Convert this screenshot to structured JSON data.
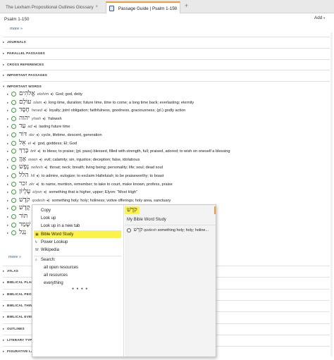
{
  "tabs": [
    {
      "label": "The Lexham Propositional Outlines Glossary",
      "close": "×"
    },
    {
      "label": "Passage Guide | Psalm 1-150",
      "close": "×"
    }
  ],
  "new_tab": "+",
  "toolbar": {
    "reference": "Psalm 1-150",
    "add_label": "Add",
    "add_caret": "▾"
  },
  "more_top": "more »",
  "sections_top": [
    "JOURNALS",
    "PARALLEL PASSAGES",
    "CROSS REFERENCES",
    "IMPORTANT PASSAGES",
    "IMPORTANT WORDS"
  ],
  "words": [
    {
      "hebrew": "אֱלֹהִים",
      "translit": "elohim",
      "gloss": "God; god, deity"
    },
    {
      "hebrew": "עוֹלָם",
      "translit": "olam",
      "gloss": "long time, duration; future time, time to come; a long time back; everlasting; eternity"
    },
    {
      "hebrew": "חֶסֶד",
      "translit": "hesed",
      "gloss": "loyalty; joint obligation; faithfulness, goodness, graciousness; (pl.) godly action"
    },
    {
      "hebrew": "יהוה",
      "translit": "yhwh",
      "gloss": "Yahweh"
    },
    {
      "hebrew": "עַד",
      "translit": "ad",
      "gloss": "lasting future time"
    },
    {
      "hebrew": "דּוֹר",
      "translit": "dor",
      "gloss": "cycle, lifetime, descent, generation"
    },
    {
      "hebrew": "אֵל",
      "translit": "el",
      "gloss": "god, goddess; El; God"
    },
    {
      "hebrew": "בָּרַךְ",
      "translit": "brk",
      "gloss": "to bless; to praise; (pt. pass) blessed, filled with strength, full; praised, adored; to wish on oneself a blessing"
    },
    {
      "hebrew": "אָוֶן",
      "translit": "owen",
      "gloss": "evil; calamity; sin, injustice; deception; false, idolatrous"
    },
    {
      "hebrew": "נֶפֶשׁ",
      "translit": "nefesh",
      "gloss": "throat; neck; breath; living being; personality; life; soul; dead soul"
    },
    {
      "hebrew": "הלל",
      "translit": "hll",
      "gloss": "to admire, eulogize; to exclaim Halleluiah; to be praiseworthy; to boast"
    },
    {
      "hebrew": "זכר",
      "translit": "zkr",
      "gloss": "to name, mention, remember; to take to court, make known, profess, praise"
    },
    {
      "hebrew": "עֶלְיוֹן",
      "translit": "elyon",
      "gloss": "something that is higher, upper; Elyon: “Most High”"
    },
    {
      "hebrew": "קֹדֶשׁ",
      "translit": "qodesh",
      "gloss": "something holy; holy; holiness; votive offerings; holy area, sanctuary"
    },
    {
      "hebrew": "קֶדֶשׁ",
      "translit": "",
      "gloss": ""
    },
    {
      "hebrew": "תּוֹר",
      "translit": "",
      "gloss": ""
    },
    {
      "hebrew": "שָׁמַר",
      "translit": "",
      "gloss": ""
    },
    {
      "hebrew": "נְגַל",
      "translit": "",
      "gloss": ""
    }
  ],
  "more_words": "more »",
  "sections_bottom": [
    "ATLAS",
    "BIBLICAL PLAC",
    "BIBLICAL PEOP",
    "BIBLICAL THIN",
    "BIBLICAL EVEN",
    "OUTLINES",
    "LITERARY TYPI",
    "FIGURATIVE LA"
  ],
  "context_menu": {
    "items": [
      {
        "label": "Copy",
        "icon": ""
      },
      {
        "label": "Look up",
        "icon": ""
      },
      {
        "label": "Look up in a new tab",
        "icon": ""
      },
      {
        "label": "Bible Word Study",
        "icon": "bible-word-study-icon",
        "highlighted": true
      },
      {
        "label": "Power Lookup",
        "icon": "power-lookup-icon"
      },
      {
        "label": "Wikipedia",
        "icon": "wikipedia-icon"
      },
      {
        "label": "Search:",
        "icon": "search-icon"
      },
      {
        "label": "all open resources",
        "icon": ""
      },
      {
        "label": "all resources",
        "icon": ""
      },
      {
        "label": "everything",
        "icon": ""
      }
    ],
    "dots": "● ● ● ●",
    "selected_word": "קֹדֶשׁ",
    "right_title": "My Bible Word Study",
    "right_entry": {
      "hebrew": "קֹדֶשׁ",
      "translit": "qodesh",
      "gloss": "something holy; holy; holine..."
    }
  },
  "colors": {
    "highlight": "#fbf24a",
    "accent_orange": "#f29b38",
    "link": "#2a5db0",
    "circle_green": "#3f9d3f"
  }
}
